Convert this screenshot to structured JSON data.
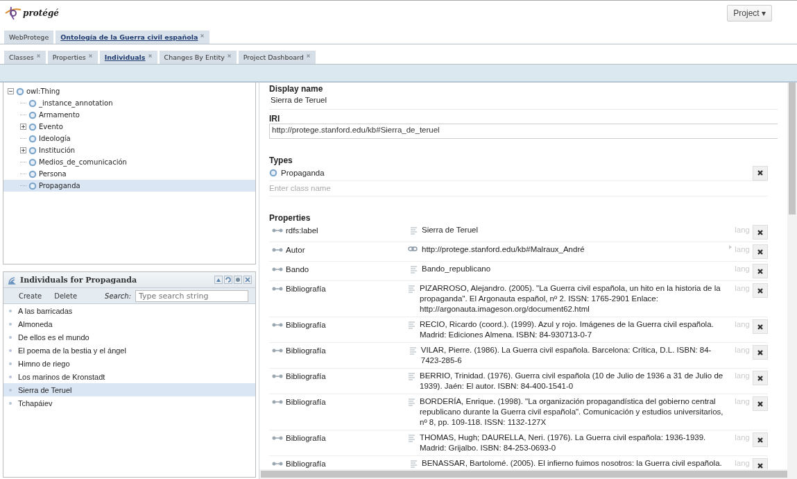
{
  "header": {
    "logo_text": "protégé",
    "project_menu": "Project ▾"
  },
  "project_tabs": [
    {
      "label": "WebProtege",
      "selected": false,
      "closable": false
    },
    {
      "label": "Ontología de la Guerra civil española",
      "selected": true,
      "closable": true
    }
  ],
  "entity_tabs": [
    {
      "label": "Classes",
      "selected": false
    },
    {
      "label": "Properties",
      "selected": false
    },
    {
      "label": "Individuals",
      "selected": true
    },
    {
      "label": "Changes By Entity",
      "selected": false
    },
    {
      "label": "Project Dashboard",
      "selected": false
    }
  ],
  "class_tree": [
    {
      "label": "owl:Thing",
      "kind": "expanded",
      "selected": false,
      "children": [
        {
          "label": "_instance_annotation",
          "kind": "leaf",
          "selected": false
        },
        {
          "label": "Armamento",
          "kind": "leaf",
          "selected": false
        },
        {
          "label": "Evento",
          "kind": "collapsed",
          "selected": false
        },
        {
          "label": "Ideología",
          "kind": "leaf",
          "selected": false
        },
        {
          "label": "Institución",
          "kind": "collapsed",
          "selected": false
        },
        {
          "label": "Medios_de_comunicación",
          "kind": "leaf",
          "selected": false
        },
        {
          "label": "Persona",
          "kind": "leaf",
          "selected": false
        },
        {
          "label": "Propaganda",
          "kind": "leaf",
          "selected": true
        }
      ]
    }
  ],
  "individuals": {
    "title": "Individuals for Propaganda",
    "create": "Create",
    "delete": "Delete",
    "search_label": "Search:",
    "search_placeholder": "Type search string",
    "items": [
      {
        "label": "A las barricadas",
        "selected": false
      },
      {
        "label": "Almoneda",
        "selected": false
      },
      {
        "label": "De ellos es el mundo",
        "selected": false
      },
      {
        "label": "El poema de la bestia y el ángel",
        "selected": false
      },
      {
        "label": "Himno de riego",
        "selected": false
      },
      {
        "label": "Los marinos de Kronstadt",
        "selected": false
      },
      {
        "label": "Sierra de Teruel",
        "selected": true
      },
      {
        "label": "Tchapáiev",
        "selected": false
      }
    ]
  },
  "editor": {
    "display_name_label": "Display name",
    "display_name": "Sierra de Teruel",
    "iri_label": "IRI",
    "iri": "http://protege.stanford.edu/kb#Sierra_de_teruel",
    "types_label": "Types",
    "types": [
      "Propaganda"
    ],
    "type_placeholder": "Enter class name",
    "properties_label": "Properties",
    "properties": [
      {
        "property": "rdfs:label",
        "kind": "literal",
        "value": "Sierra de Teruel",
        "lang": "lang"
      },
      {
        "property": "Autor",
        "kind": "iri",
        "value": "http://protege.stanford.edu/kb#Malraux_André",
        "lang": "lang"
      },
      {
        "property": "Bando",
        "kind": "literal",
        "value": "Bando_republicano",
        "lang": "lang"
      },
      {
        "property": "Bibliografía",
        "kind": "literal",
        "value": "PIZARROSO, Alejandro. (2005). \"La Guerra civil española, un hito en la historia de la propaganda\". El Argonauta español,  nº 2. ISSN: 1765-2901 Enlace: http://argonauta.imageson.org/document62.html",
        "lang": "lang"
      },
      {
        "property": "Bibliografía",
        "kind": "literal",
        "value": "RECIO, Ricardo (coord.). (1999). Azul y rojo. Imágenes de la Guerra civil española. Madrid: Ediciones Almena. ISBN: 84-930713-0-7",
        "lang": "lang"
      },
      {
        "property": "Bibliografía",
        "kind": "literal",
        "value": "VILAR, Pierre. (1986). La Guerra civil española. Barcelona: Crítica, D.L. ISBN: 84-7423-285-6",
        "lang": "lang"
      },
      {
        "property": "Bibliografía",
        "kind": "literal",
        "value": "BERRIO, Trinidad. (1976). Guerra civil española (10 de Julio de 1936 a 31 de Julio de 1939). Jaén: El autor. ISBN: 84-400-1541-0",
        "lang": "lang"
      },
      {
        "property": "Bibliografía",
        "kind": "literal",
        "value": "BORDERÍA, Enrique. (1998). \"La organización propagandística del gobierno central republicano durante la Guerra civil española\". Comunicación y estudios universitarios, nº 8, pp. 109-118. ISSN: 1132-127X",
        "lang": "lang"
      },
      {
        "property": "Bibliografía",
        "kind": "literal",
        "value": "THOMAS, Hugh; DAURELLA, Neri. (1976). La Guerra civil española: 1936-1939. Madrid: Grijalbo.  ISBN: 84-253-0693-0",
        "lang": "lang"
      },
      {
        "property": "Bibliografía",
        "kind": "literal",
        "value": "BENASSAR, Bartolomé. (2005). El infierno fuimos nosotros: la Guerra civil española.",
        "lang": "lang"
      }
    ]
  }
}
